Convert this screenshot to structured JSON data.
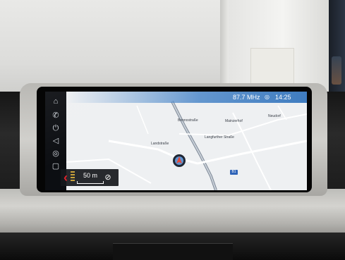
{
  "photo_subject": "Car infotainment screen with navigation map",
  "status_bar": {
    "radio_frequency": "87.7 MHz",
    "radio_icon": "radio-signal-icon",
    "clock": "14:25"
  },
  "side_menu": {
    "items": [
      {
        "icon": "home-icon",
        "glyph": "⌂"
      },
      {
        "icon": "phone-icon",
        "glyph": "✆"
      },
      {
        "icon": "power-icon",
        "glyph": "⏻"
      },
      {
        "icon": "speaker-icon",
        "glyph": "◁"
      },
      {
        "icon": "connected-drive-icon",
        "glyph": "◎"
      },
      {
        "icon": "map-book-icon",
        "glyph": "▢"
      }
    ]
  },
  "map": {
    "labels": [
      {
        "text": "Bennostraße"
      },
      {
        "text": "Mainzerhof"
      },
      {
        "text": "Neudorf"
      },
      {
        "text": "Langfurther Straße"
      },
      {
        "text": "Landstraße"
      }
    ],
    "route_badge": "B1",
    "colors": {
      "background": "#eef0f2",
      "road": "#ffffff",
      "major_road": "#7d8896",
      "accent": "#3f7cc0"
    }
  },
  "scale": {
    "distance": "50 m",
    "back_icon": "chevron-left-icon",
    "compass_icon": "compass-icon"
  }
}
